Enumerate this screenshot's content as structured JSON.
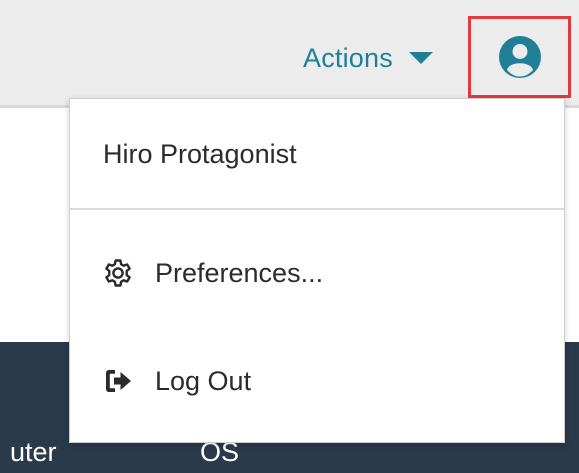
{
  "header": {
    "actions_label": "Actions",
    "accent_color": "#1f7f97",
    "highlight_color": "#e03a3e",
    "user_icon": "user-circle-icon",
    "caret_icon": "caret-down-icon"
  },
  "user_menu": {
    "username": "Hiro Protagonist",
    "items": [
      {
        "label": "Preferences...",
        "icon": "gear-icon"
      },
      {
        "label": "Log Out",
        "icon": "sign-out-icon"
      }
    ]
  },
  "table": {
    "columns": [
      "uter",
      "OS"
    ],
    "header_color": "#2a3a4b"
  }
}
